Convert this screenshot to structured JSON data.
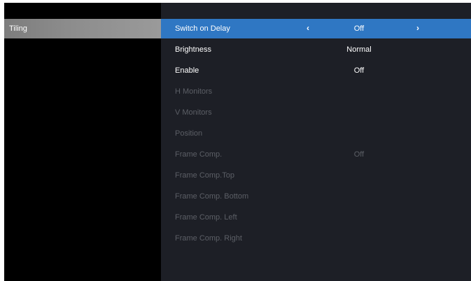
{
  "menu": {
    "left": {
      "selected_label": "Tiling"
    },
    "rows": [
      {
        "label": "Switch on Delay",
        "value": "Off",
        "selected": true,
        "enabled": true
      },
      {
        "label": "Brightness",
        "value": "Normal",
        "selected": false,
        "enabled": true
      },
      {
        "label": "Enable",
        "value": "Off",
        "selected": false,
        "enabled": true
      },
      {
        "label": "H Monitors",
        "value": "",
        "selected": false,
        "enabled": false
      },
      {
        "label": "V Monitors",
        "value": "",
        "selected": false,
        "enabled": false
      },
      {
        "label": "Position",
        "value": "",
        "selected": false,
        "enabled": false
      },
      {
        "label": "Frame Comp.",
        "value": "Off",
        "selected": false,
        "enabled": false
      },
      {
        "label": "Frame Comp.Top",
        "value": "",
        "selected": false,
        "enabled": false
      },
      {
        "label": "Frame Comp. Bottom",
        "value": "",
        "selected": false,
        "enabled": false
      },
      {
        "label": "Frame Comp. Left",
        "value": "",
        "selected": false,
        "enabled": false
      },
      {
        "label": "Frame Comp. Right",
        "value": "",
        "selected": false,
        "enabled": false
      }
    ],
    "arrows": {
      "left": "‹",
      "right": "›"
    }
  },
  "colors": {
    "selected_row": "#2f77c3",
    "panel_bg": "#1d1f26",
    "left_bg": "#000000",
    "disabled_text": "#5c5f66",
    "left_selected": "#8c8c8c"
  }
}
